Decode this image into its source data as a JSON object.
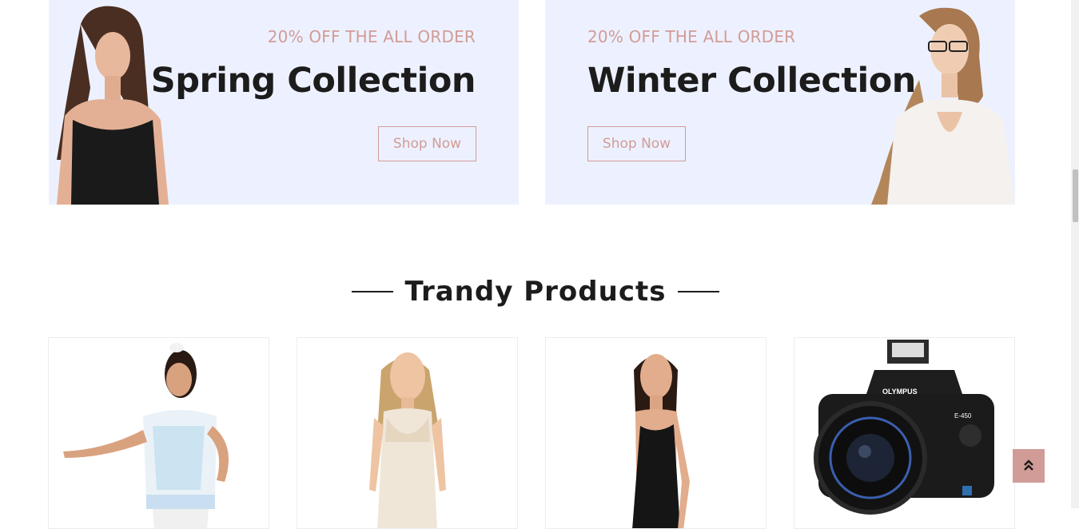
{
  "banners": [
    {
      "offer": "20% OFF THE ALL ORDER",
      "title": "Spring Collection",
      "button": "Shop Now"
    },
    {
      "offer": "20% OFF THE ALL ORDER",
      "title": "Winter Collection",
      "button": "Shop Now"
    }
  ],
  "section": {
    "title": "Trandy Products"
  },
  "products": [
    {
      "image": "girl-in-white-top-photo"
    },
    {
      "image": "woman-in-cream-dress-photo"
    },
    {
      "image": "woman-in-black-dress-photo"
    },
    {
      "image": "olympus-camera-photo",
      "brand_text": "OLYMPUS",
      "model_text": "E-450"
    }
  ],
  "colors": {
    "accent": "#d19c97",
    "banner_bg": "#edf1ff",
    "heading": "#1c1c1c"
  },
  "icons": {
    "back_to_top": "double-chevron-up-icon"
  }
}
